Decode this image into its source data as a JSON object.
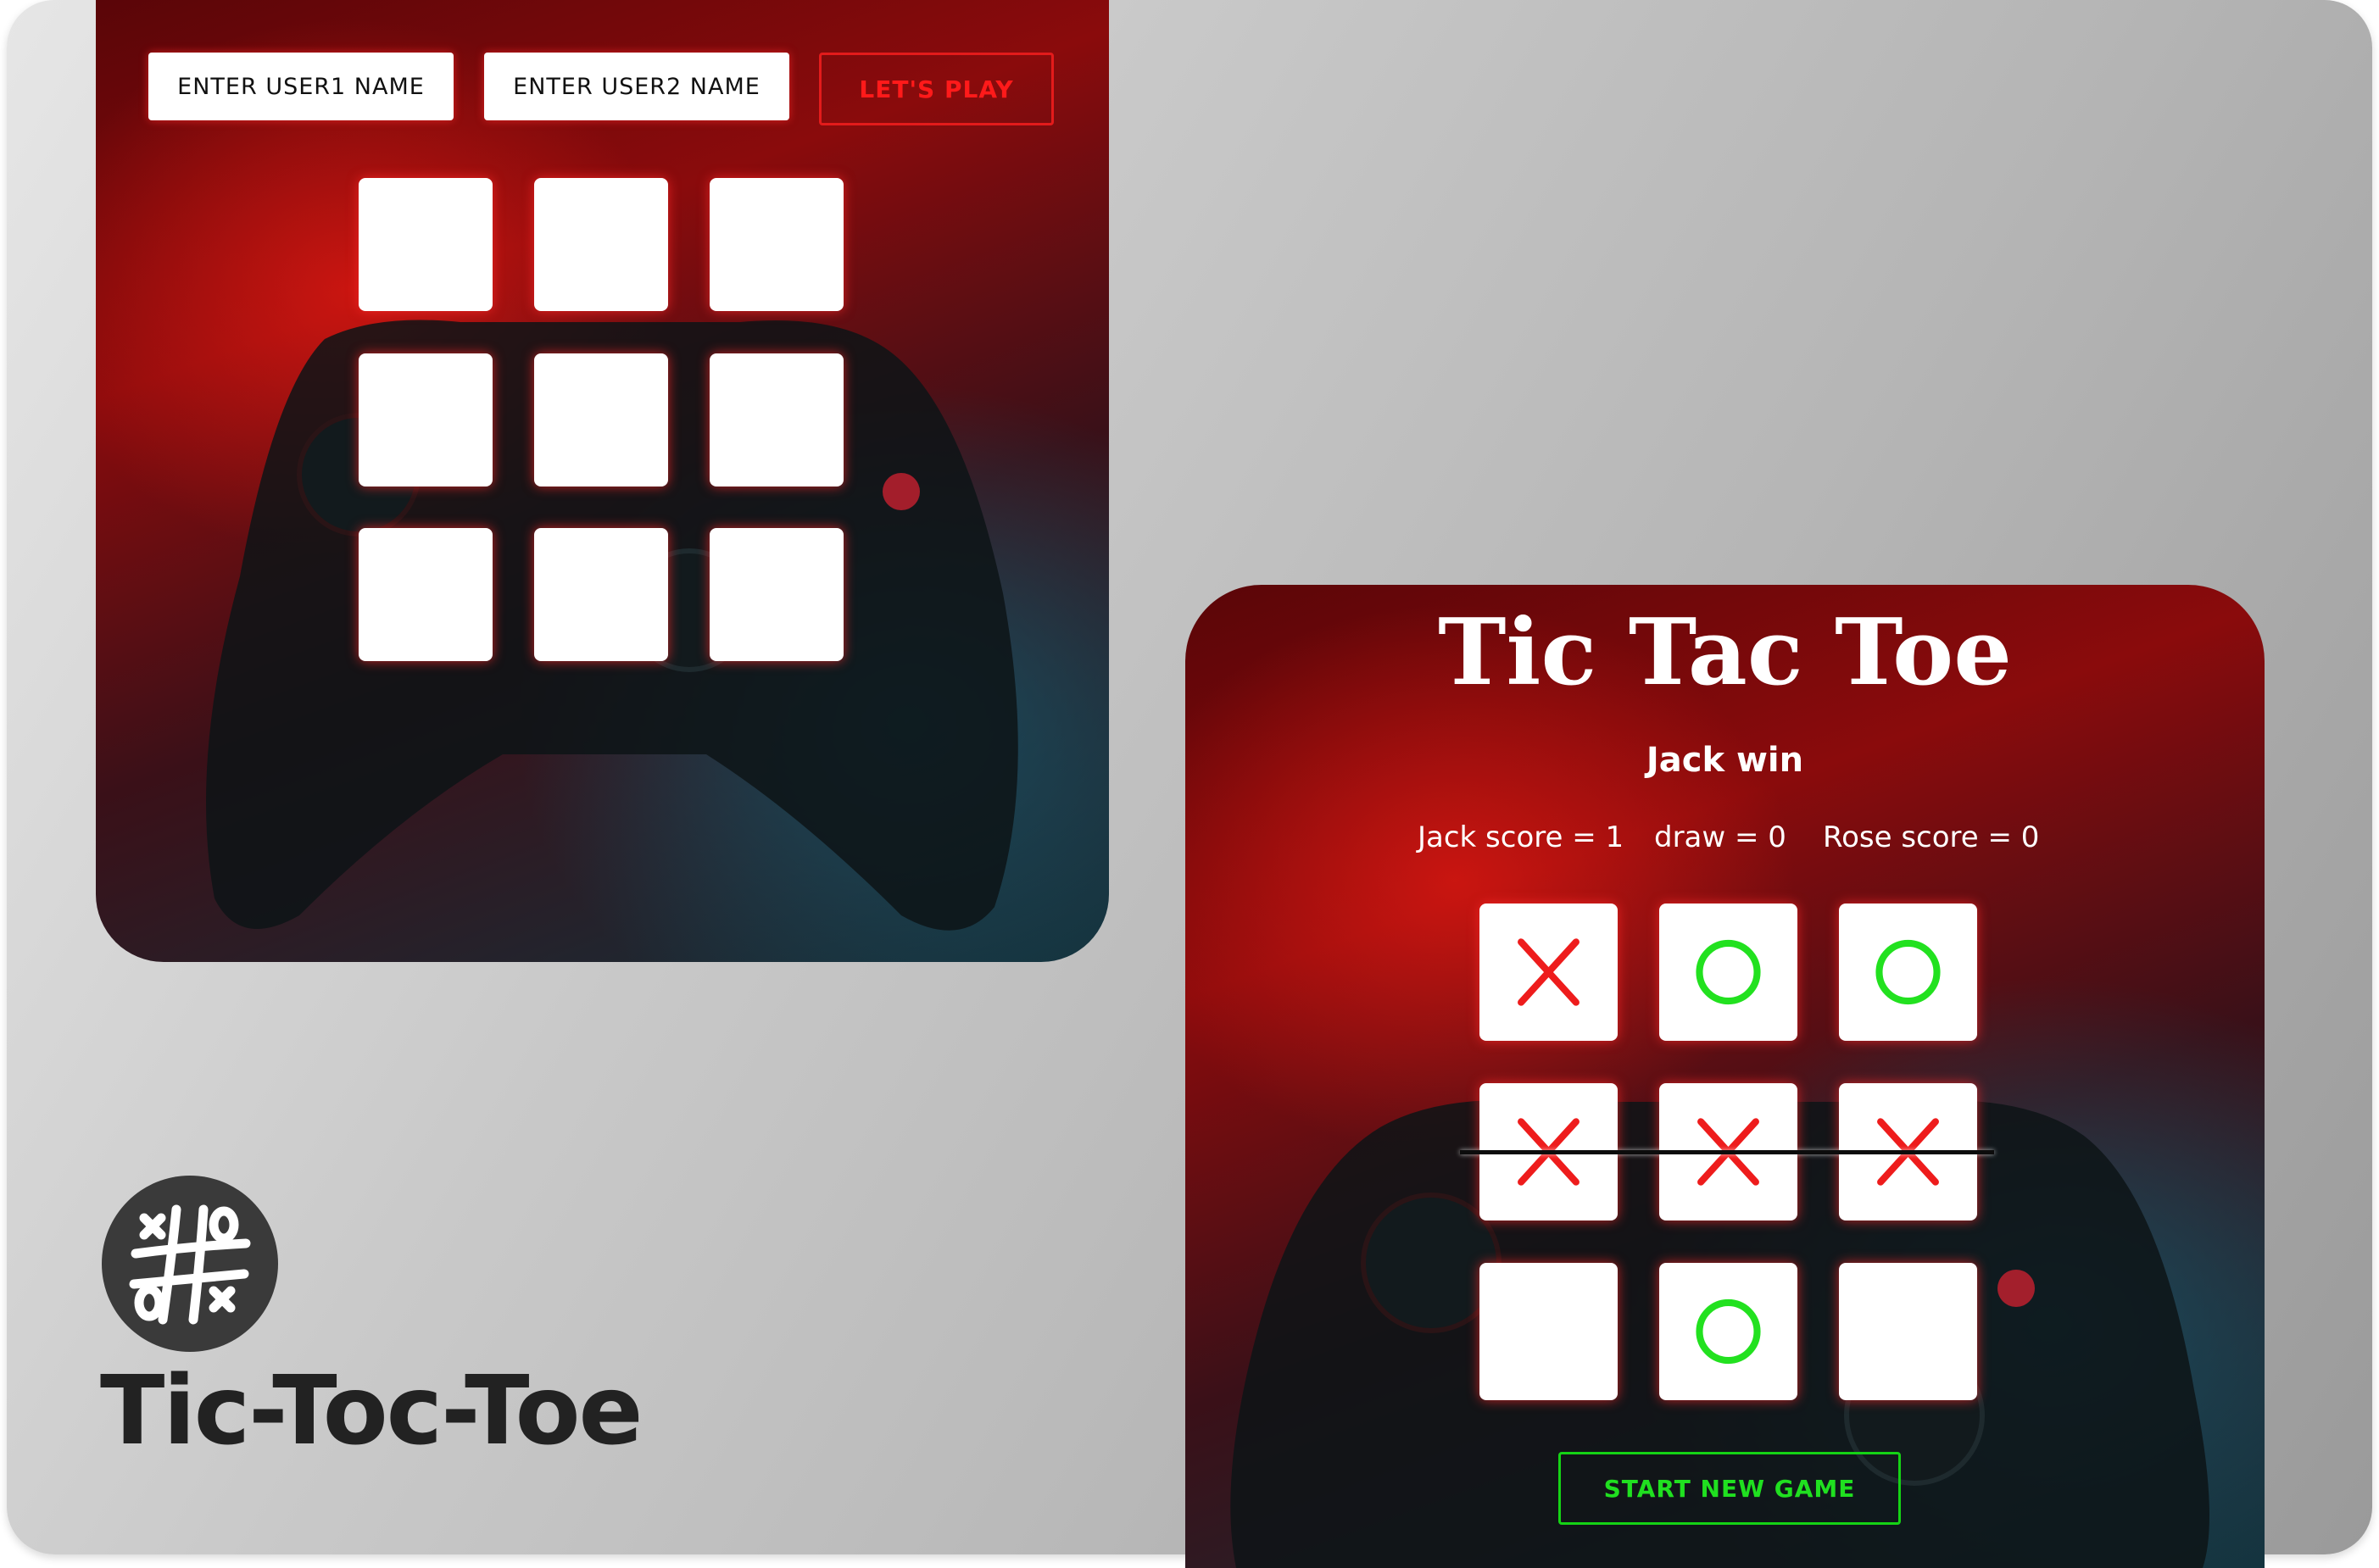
{
  "setup": {
    "user1_placeholder": "ENTER USER1 NAME",
    "user2_placeholder": "ENTER USER2 NAME",
    "play_button": "LET'S PLAY",
    "board": [
      "",
      "",
      "",
      "",
      "",
      "",
      "",
      "",
      ""
    ]
  },
  "game": {
    "title": "Tic Tac Toe",
    "status": "Jack win",
    "scores": {
      "player1": "Jack score = 1",
      "draw": "draw = 0",
      "player2": "Rose score = 0"
    },
    "board": [
      "X",
      "O",
      "O",
      "X",
      "X",
      "X",
      "",
      "O",
      ""
    ],
    "winning_row": 2,
    "new_game_button": "START NEW GAME"
  },
  "brand": {
    "name": "Tic-Toc-Toe",
    "logo_icon": "tic-tac-toe-logo-icon"
  },
  "colors": {
    "x_mark": "#ee1c1c",
    "o_mark": "#22e11f",
    "play_button": "#e31b1b",
    "new_game_button": "#15d315",
    "logo_bg": "#3a3a3a"
  }
}
